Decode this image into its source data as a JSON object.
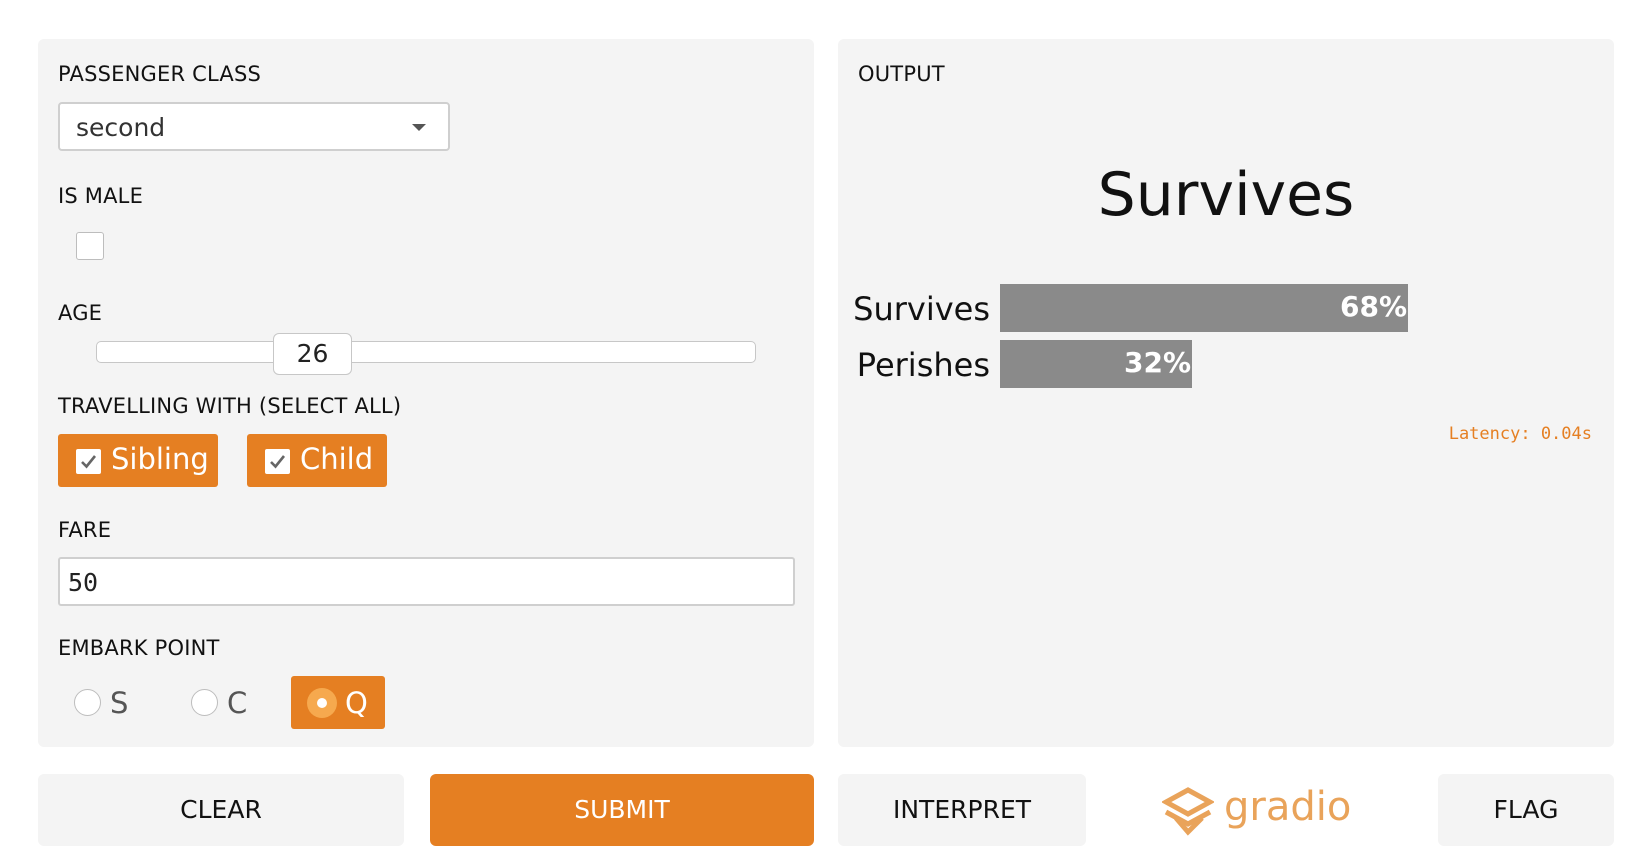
{
  "inputs": {
    "passenger_class": {
      "label": "PASSENGER CLASS",
      "value": "second"
    },
    "is_male": {
      "label": "IS MALE",
      "checked": false
    },
    "age": {
      "label": "AGE",
      "value": "26",
      "min": 0,
      "max": 80
    },
    "travelling_with": {
      "label": "TRAVELLING WITH (SELECT ALL)",
      "options": [
        {
          "label": "Sibling",
          "checked": true
        },
        {
          "label": "Child",
          "checked": true
        }
      ]
    },
    "fare": {
      "label": "FARE",
      "value": "50"
    },
    "embark_point": {
      "label": "EMBARK POINT",
      "options": [
        "S",
        "C",
        "Q"
      ],
      "selected": "Q"
    }
  },
  "output": {
    "label": "OUTPUT",
    "title": "Survives",
    "bars": [
      {
        "label": "Survives",
        "value": 0.68,
        "display": "68%"
      },
      {
        "label": "Perishes",
        "value": 0.32,
        "display": "32%"
      }
    ],
    "latency": "Latency: 0.04s"
  },
  "buttons": {
    "clear": "CLEAR",
    "submit": "SUBMIT",
    "interpret": "INTERPRET",
    "flag": "FLAG"
  },
  "logo_text": "gradio",
  "colors": {
    "accent": "#e57f22",
    "panel": "#f4f4f4",
    "bar": "#8a8a8a"
  }
}
